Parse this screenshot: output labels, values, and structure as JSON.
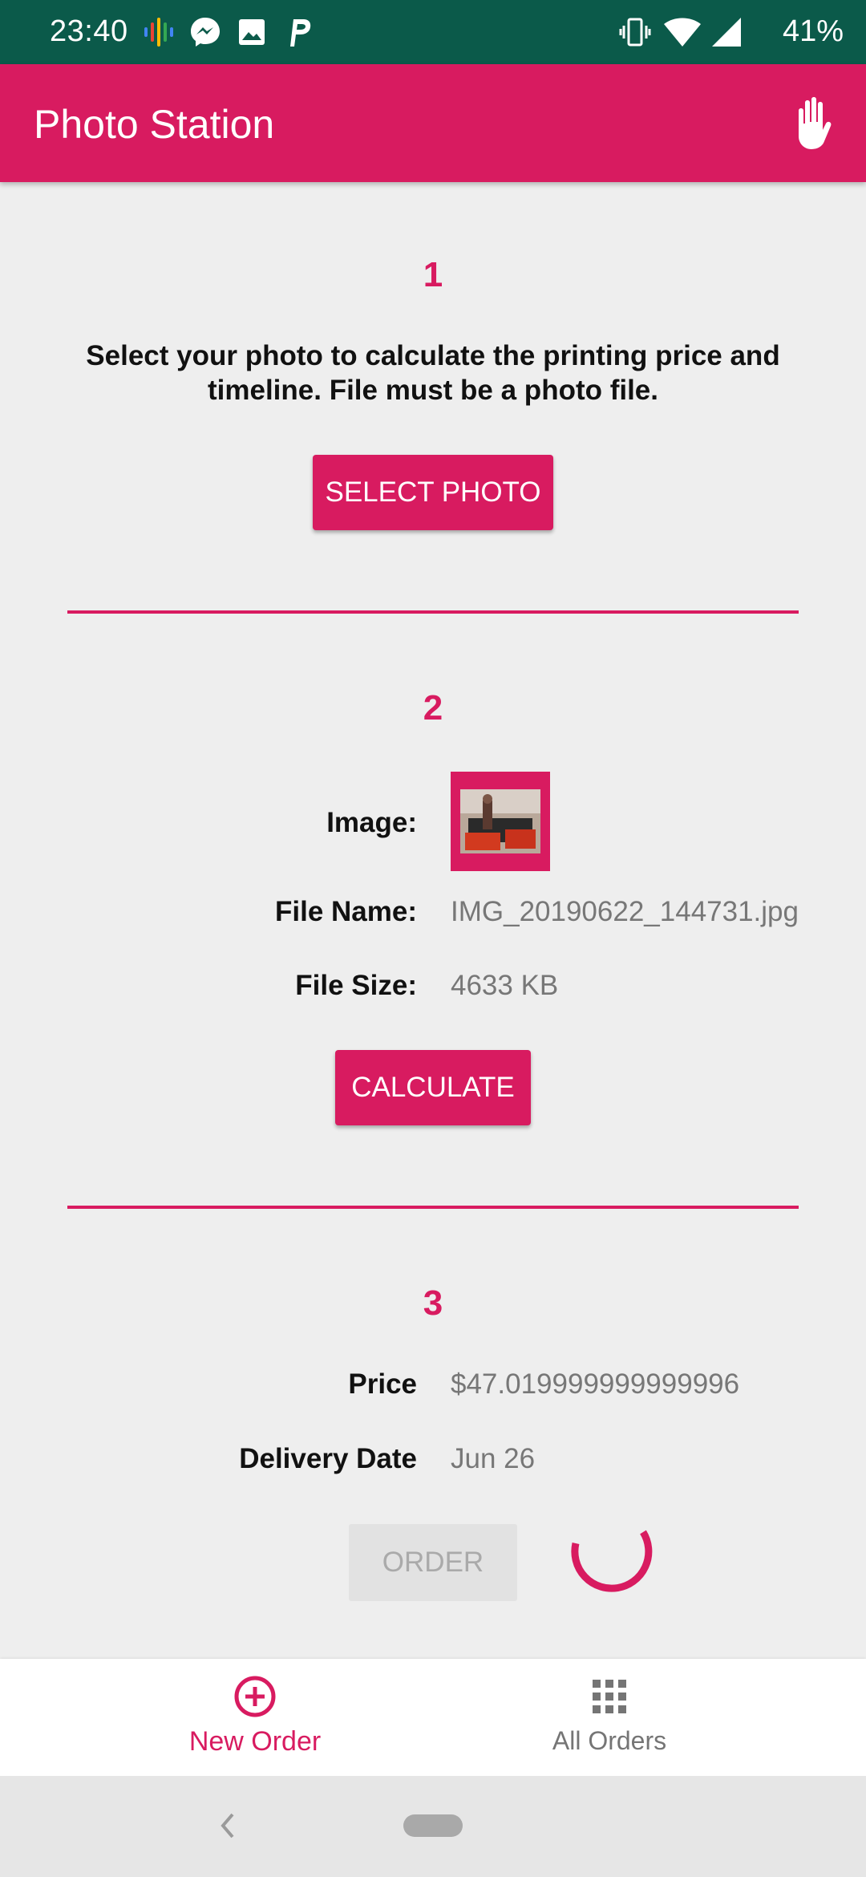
{
  "status_bar": {
    "time": "23:40",
    "battery": "41%",
    "icons": [
      "podcasts-icon",
      "messenger-icon",
      "gallery-icon",
      "p-app-icon",
      "vibrate-icon",
      "wifi-icon",
      "signal-icon"
    ]
  },
  "app_bar": {
    "title": "Photo Station",
    "action_icon": "hand-icon"
  },
  "section1": {
    "number": "1",
    "instruction": "Select your photo to calculate the printing price and timeline. File must be a photo file.",
    "button": "SELECT PHOTO"
  },
  "section2": {
    "number": "2",
    "image_label": "Image:",
    "file_name_label": "File Name:",
    "file_name": "IMG_20190622_144731.jpg",
    "file_size_label": "File Size:",
    "file_size": "4633 KB",
    "button": "CALCULATE"
  },
  "section3": {
    "number": "3",
    "price_label": "Price",
    "price": "$47.019999999999996",
    "delivery_label": "Delivery Date",
    "delivery_date": "Jun 26",
    "order_button": "ORDER"
  },
  "bottom_nav": {
    "items": [
      {
        "label": "New Order",
        "icon": "add-circle-icon",
        "active": true
      },
      {
        "label": "All Orders",
        "icon": "grid-icon",
        "active": false
      }
    ]
  },
  "colors": {
    "primary": "#d81b60",
    "status_bar": "#0b5a4a",
    "background": "#eeeeee",
    "inactive": "#757575"
  }
}
